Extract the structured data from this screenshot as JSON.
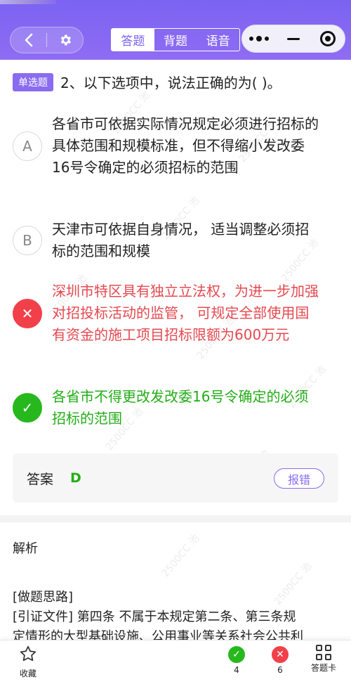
{
  "header": {
    "tabs": [
      {
        "label": "答题",
        "active": true
      },
      {
        "label": "背题",
        "active": false
      },
      {
        "label": "语音",
        "active": false
      }
    ],
    "back_icon": "back-arrow-icon",
    "settings_icon": "gear-icon"
  },
  "question": {
    "type_badge": "单选题",
    "text": "2、以下选项中，说法正确的为(   )。",
    "options": [
      {
        "marker": "A",
        "text": "各省市可依据实际情况规定必须进行招标的具体范围和规模标准，但不得缩小发改委16号令确定的必须招标的范围",
        "state": "normal"
      },
      {
        "marker": "B",
        "text": "天津市可依据自身情况， 适当调整必须招标的范围和规模",
        "state": "normal"
      },
      {
        "marker": "✕",
        "text": "深圳市特区具有独立立法权，为进一步加强对招投标活动的监管， 可规定全部使用国有资金的施工项目招标限额为600万元",
        "state": "wrong"
      },
      {
        "marker": "✓",
        "text": "各省市不得更改发改委16号令确定的必须招标的范围",
        "state": "right"
      }
    ]
  },
  "answer": {
    "label": "答案",
    "value": "D",
    "report_label": "报错"
  },
  "analysis": {
    "title": "解析",
    "line1": "[做题思路]",
    "line2": "[引证文件] 第四条    不属于本规定第二条、第三条规",
    "line3": "定情形的大型基础设施、公用事业等关系社会公共利"
  },
  "bottom_bar": {
    "favorite_label": "收藏",
    "correct_count": "4",
    "wrong_count": "6",
    "answer_card_label": "答题卡"
  },
  "watermark": "2500CC 池",
  "colors": {
    "accent": "#8a6cf0",
    "correct": "#27b81d",
    "wrong": "#f2404a"
  }
}
